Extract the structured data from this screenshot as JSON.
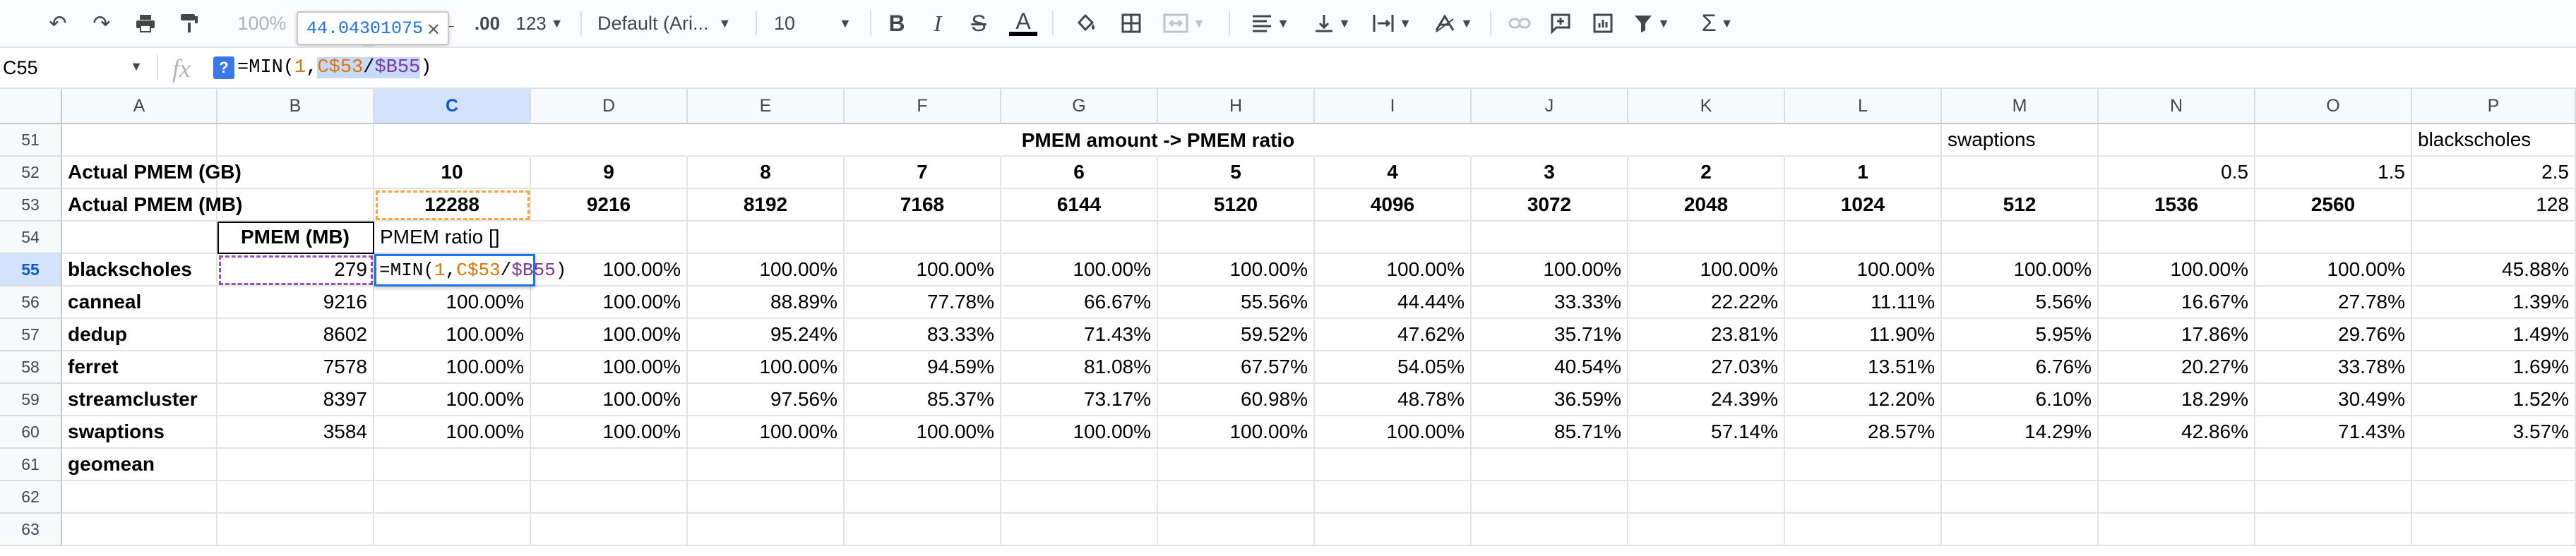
{
  "toolbar": {
    "zoom": "100%",
    "currency": "$",
    "percent": "%",
    "decimals_more": ".00",
    "format_number": "123",
    "font_family": "Default (Ari...",
    "font_size": "10",
    "bold_label": "B",
    "italic_label": "I",
    "strike_label": "S",
    "text_color_label": "A",
    "tooltip_value": "44.04301075"
  },
  "formula_bar": {
    "cell_ref": "C55",
    "fx_label": "fx",
    "help_label": "?",
    "formula_parts": [
      "=MIN(",
      "1",
      ", ",
      "C$53",
      "/",
      "$B55",
      ")"
    ]
  },
  "columns": [
    "A",
    "B",
    "C",
    "D",
    "E",
    "F",
    "G",
    "H",
    "I",
    "J",
    "K",
    "L",
    "M",
    "N",
    "O",
    "P"
  ],
  "rows": [
    {
      "num": "51",
      "cells": [
        "",
        "",
        "",
        "",
        "",
        "",
        "",
        "",
        "",
        "",
        "",
        "",
        "swaptions",
        "",
        "",
        "blackscholes"
      ]
    },
    {
      "num": "52",
      "cells": [
        "Actual PMEM (GB)",
        "",
        "10",
        "9",
        "8",
        "7",
        "6",
        "5",
        "4",
        "3",
        "2",
        "1",
        "",
        "0.5",
        "1.5",
        "2.5"
      ]
    },
    {
      "num": "53",
      "cells": [
        "Actual PMEM (MB)",
        "",
        "12288",
        "9216",
        "8192",
        "7168",
        "6144",
        "5120",
        "4096",
        "3072",
        "2048",
        "1024",
        "512",
        "1536",
        "2560",
        "128"
      ]
    },
    {
      "num": "54",
      "cells": [
        "",
        "PMEM (MB)",
        "PMEM ratio []",
        "",
        "",
        "",
        "",
        "",
        "",
        "",
        "",
        "",
        "",
        "",
        "",
        ""
      ]
    },
    {
      "num": "55",
      "cells": [
        "blackscholes",
        "279",
        "",
        "100.00%",
        "100.00%",
        "100.00%",
        "100.00%",
        "100.00%",
        "100.00%",
        "100.00%",
        "100.00%",
        "100.00%",
        "100.00%",
        "100.00%",
        "100.00%",
        "45.88%"
      ]
    },
    {
      "num": "56",
      "cells": [
        "canneal",
        "9216",
        "100.00%",
        "100.00%",
        "88.89%",
        "77.78%",
        "66.67%",
        "55.56%",
        "44.44%",
        "33.33%",
        "22.22%",
        "11.11%",
        "5.56%",
        "16.67%",
        "27.78%",
        "1.39%"
      ]
    },
    {
      "num": "57",
      "cells": [
        "dedup",
        "8602",
        "100.00%",
        "100.00%",
        "95.24%",
        "83.33%",
        "71.43%",
        "59.52%",
        "47.62%",
        "35.71%",
        "23.81%",
        "11.90%",
        "5.95%",
        "17.86%",
        "29.76%",
        "1.49%"
      ]
    },
    {
      "num": "58",
      "cells": [
        "ferret",
        "7578",
        "100.00%",
        "100.00%",
        "100.00%",
        "94.59%",
        "81.08%",
        "67.57%",
        "54.05%",
        "40.54%",
        "27.03%",
        "13.51%",
        "6.76%",
        "20.27%",
        "33.78%",
        "1.69%"
      ]
    },
    {
      "num": "59",
      "cells": [
        "streamcluster",
        "8397",
        "100.00%",
        "100.00%",
        "97.56%",
        "85.37%",
        "73.17%",
        "60.98%",
        "48.78%",
        "36.59%",
        "24.39%",
        "12.20%",
        "6.10%",
        "18.29%",
        "30.49%",
        "1.52%"
      ]
    },
    {
      "num": "60",
      "cells": [
        "swaptions",
        "3584",
        "100.00%",
        "100.00%",
        "100.00%",
        "100.00%",
        "100.00%",
        "100.00%",
        "100.00%",
        "85.71%",
        "57.14%",
        "28.57%",
        "14.29%",
        "42.86%",
        "71.43%",
        "3.57%"
      ]
    },
    {
      "num": "61",
      "cells": [
        "geomean",
        "",
        "",
        "",
        "",
        "",
        "",
        "",
        "",
        "",
        "",
        "",
        "",
        "",
        "",
        ""
      ]
    },
    {
      "num": "62",
      "cells": [
        "",
        "",
        "",
        "",
        "",
        "",
        "",
        "",
        "",
        "",
        "",
        "",
        "",
        "",
        "",
        ""
      ]
    },
    {
      "num": "63",
      "cells": [
        "",
        "",
        "",
        "",
        "",
        "",
        "",
        "",
        "",
        "",
        "",
        "",
        "",
        "",
        "",
        ""
      ]
    }
  ],
  "merged_header": "PMEM amount -> PMEM ratio",
  "editor_text": "=MIN(1, C$53/$B55)",
  "colors": {
    "accent": "#1a73e8",
    "selection": "#d3e3fd",
    "ref_orange": "#e37400",
    "ref_purple": "#7e3794"
  }
}
